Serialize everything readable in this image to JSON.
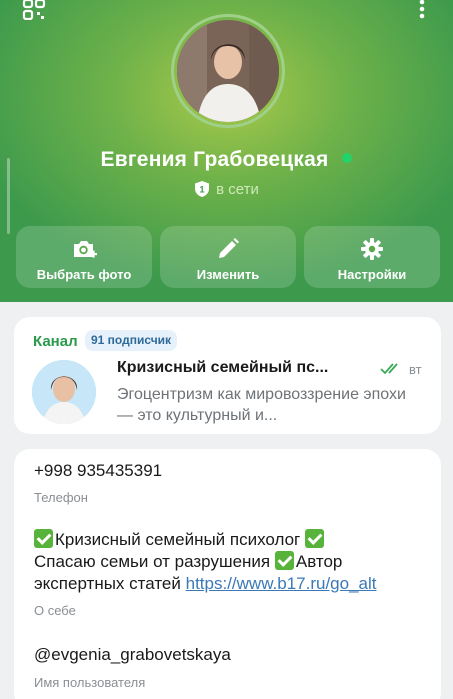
{
  "header": {
    "icons": {
      "qr": "qr-code-icon",
      "more": "more-vertical-icon"
    },
    "name": "Евгения Грабовецкая",
    "status_badge": "1",
    "status": "в сети",
    "colors": {
      "online": "#22d36a",
      "gradient_center": "#a9c94a",
      "gradient_edge": "#3d9a4c"
    }
  },
  "actions": [
    {
      "label": "Выбрать фото",
      "icon": "add-photo-icon"
    },
    {
      "label": "Изменить",
      "icon": "pencil-icon"
    },
    {
      "label": "Настройки",
      "icon": "gear-icon"
    }
  ],
  "channel": {
    "label": "Канал",
    "subscribers": "91 подписчик",
    "title": "Кризисный семейный пс...",
    "time": "вт",
    "preview": "Эгоцентризм как мировоззрение эпохи — это культурный и..."
  },
  "info": {
    "phone": "+998 935435391",
    "phone_label": "Телефон",
    "bio_line1": "Кризисный семейный психолог",
    "bio_line2_a": "Спасаю семьи от разрушения",
    "bio_line2_b": "Автор",
    "bio_line3": "экспертных статей ",
    "bio_link": "https://www.b17.ru/go_alt",
    "bio_label": "О себе",
    "username": "@evgenia_grabovetskaya",
    "username_label": "Имя пользователя"
  }
}
